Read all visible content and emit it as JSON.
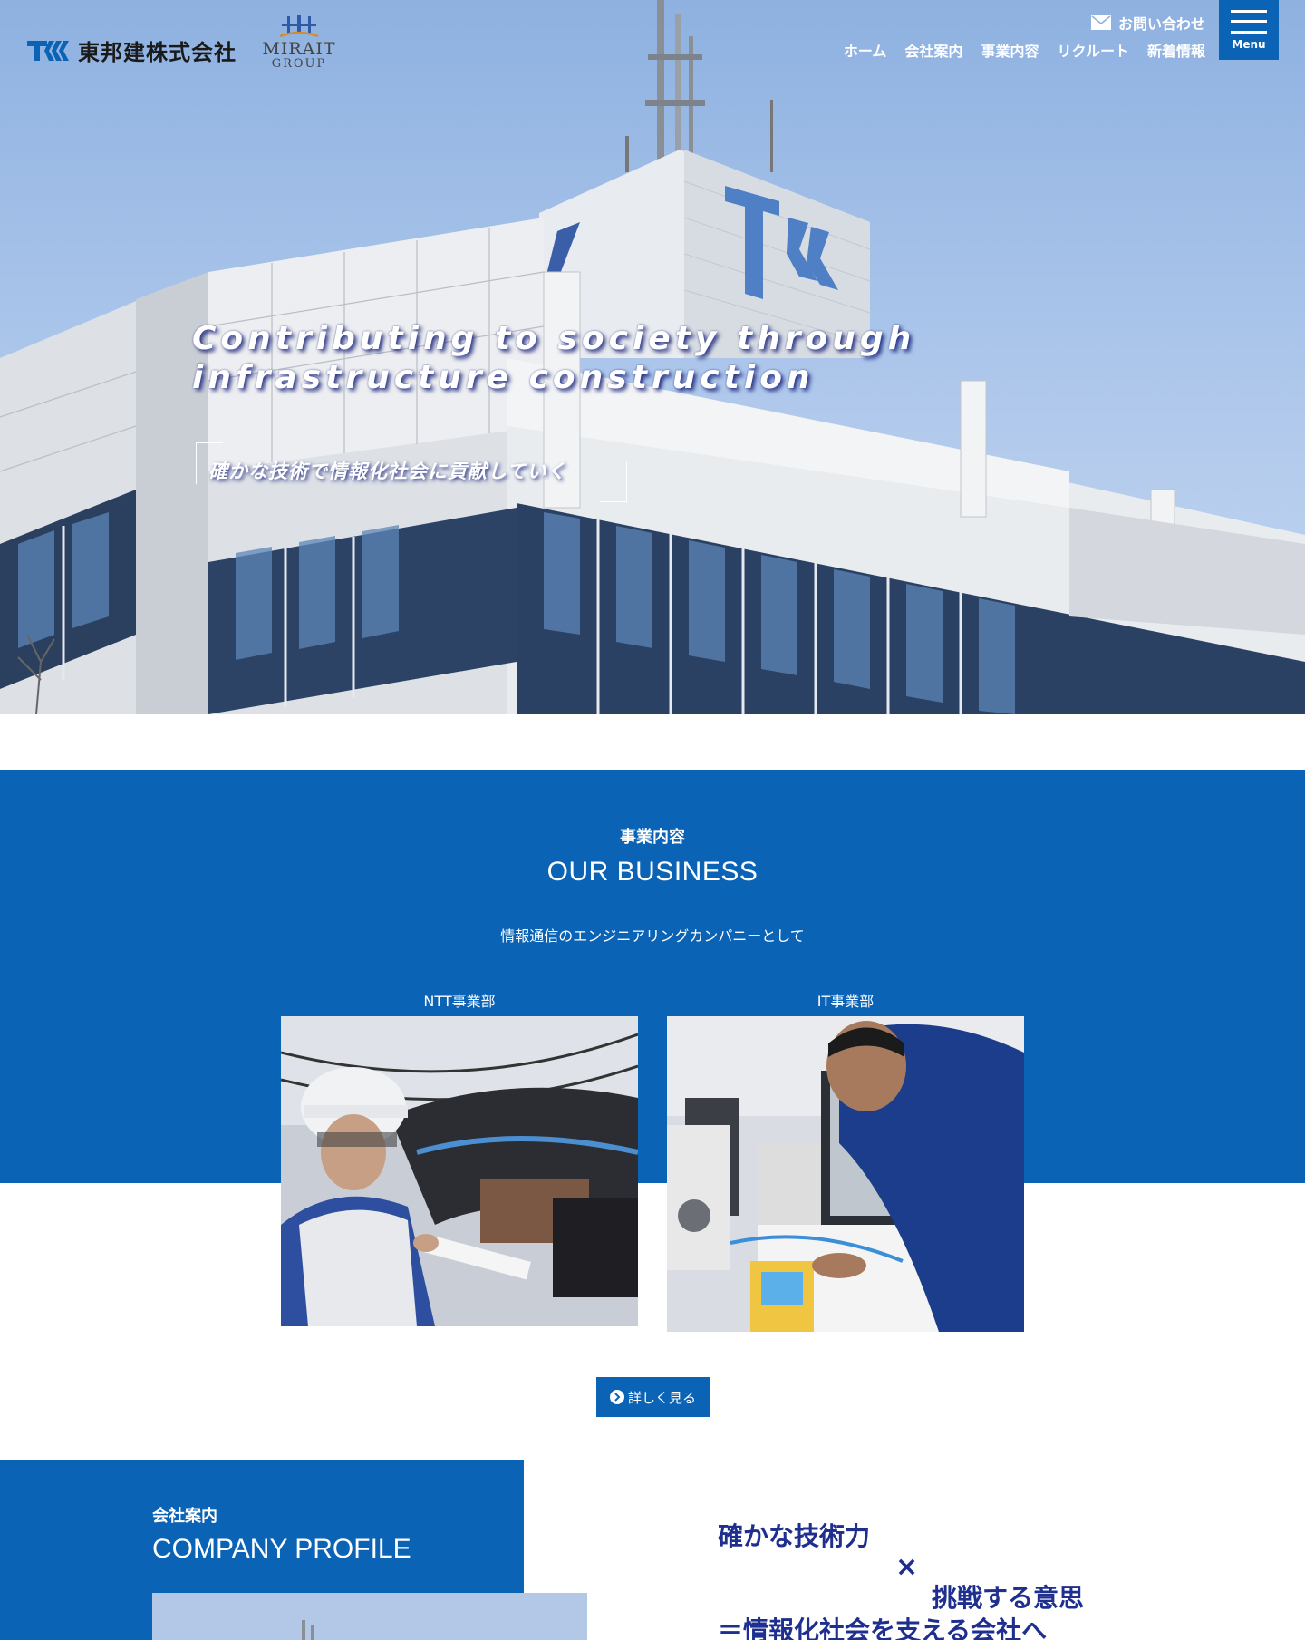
{
  "header": {
    "logo_text": "東邦建株式会社",
    "group_name": "MIRAIT",
    "group_sub": "GROUP",
    "contact_label": "お問い合わせ",
    "nav": [
      "ホーム",
      "会社案内",
      "事業内容",
      "リクルート",
      "新着情報"
    ],
    "menu_label": "Menu"
  },
  "hero": {
    "headline_line1": "Contributing to society through",
    "headline_line2": "infrastructure construction",
    "subtitle": "確かな技術で情報化社会に貢献していく"
  },
  "business": {
    "section_jp": "事業内容",
    "section_en": "OUR BUSINESS",
    "lead": "情報通信のエンジニアリングカンパニーとして",
    "cards": [
      {
        "title": "NTT事業部"
      },
      {
        "title": "IT事業部"
      }
    ],
    "detail_button": "詳しく見る"
  },
  "company": {
    "section_jp": "会社案内",
    "section_en": "COMPANY PROFILE",
    "tagline_1": "確かな技術力",
    "tagline_x": "×",
    "tagline_2": "挑戦する意思",
    "tagline_3": "＝情報化社会を支える会社へ"
  },
  "colors": {
    "brand_blue": "#0a63b5",
    "tagline_navy": "#1e2f8f"
  }
}
